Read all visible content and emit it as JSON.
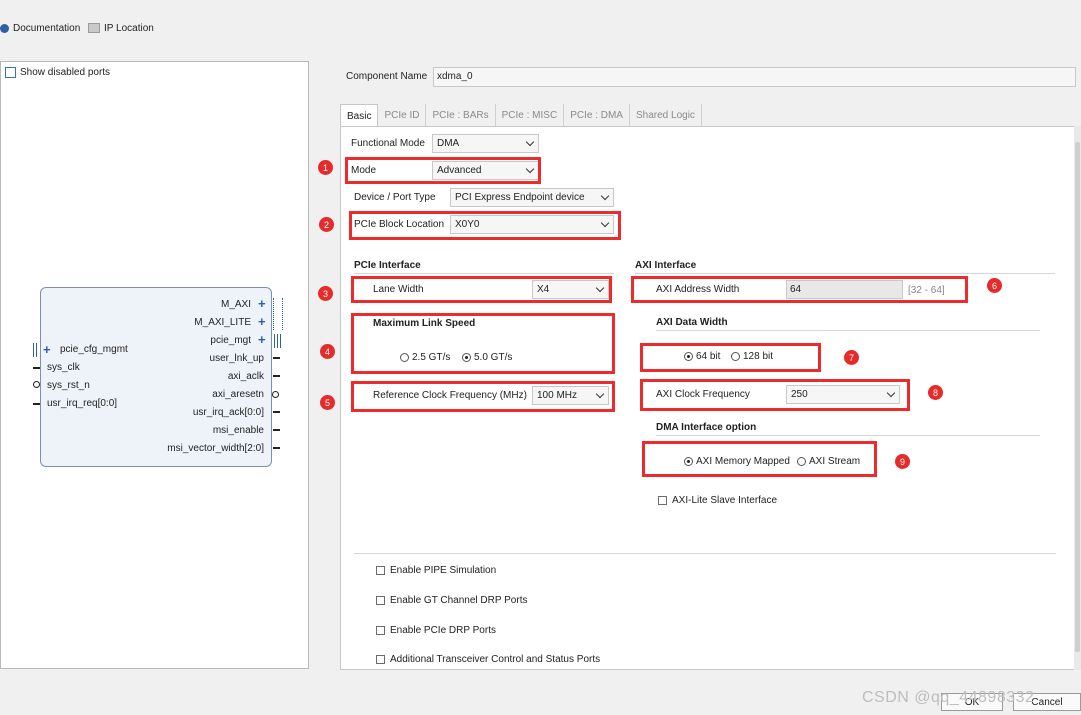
{
  "toolbar": {
    "documentation": "Documentation",
    "ip_location": "IP Location"
  },
  "left_panel": {
    "show_disabled_ports": "Show disabled ports",
    "ports_right": [
      "M_AXI",
      "M_AXI_LITE",
      "pcie_mgt",
      "user_lnk_up",
      "axi_aclk",
      "axi_aresetn",
      "usr_irq_ack[0:0]",
      "msi_enable",
      "msi_vector_width[2:0]"
    ],
    "ports_left": [
      "pcie_cfg_mgmt",
      "sys_clk",
      "sys_rst_n",
      "usr_irq_req[0:0]"
    ]
  },
  "component": {
    "label": "Component Name",
    "value": "xdma_0"
  },
  "tabs": [
    "Basic",
    "PCIe ID",
    "PCIe : BARs",
    "PCIe : MISC",
    "PCIe : DMA",
    "Shared Logic"
  ],
  "basic": {
    "functional_mode": {
      "label": "Functional Mode",
      "value": "DMA"
    },
    "mode": {
      "label": "Mode",
      "value": "Advanced"
    },
    "device_port_type": {
      "label": "Device / Port Type",
      "value": "PCI Express Endpoint device"
    },
    "pcie_block_location": {
      "label": "PCIe Block Location",
      "value": "X0Y0"
    },
    "pcie_interface": {
      "title": "PCIe Interface",
      "lane_width": {
        "label": "Lane Width",
        "value": "X4"
      },
      "max_link_speed": {
        "label": "Maximum Link Speed",
        "opt1": "2.5 GT/s",
        "opt2": "5.0 GT/s",
        "selected": "5.0 GT/s"
      },
      "ref_clock": {
        "label": "Reference Clock Frequency (MHz)",
        "value": "100 MHz"
      }
    },
    "axi_interface": {
      "title": "AXI Interface",
      "address_width": {
        "label": "AXI Address Width",
        "value": "64",
        "range": "[32 - 64]"
      },
      "data_width": {
        "title": "AXI Data Width",
        "opt1": "64 bit",
        "opt2": "128 bit",
        "selected": "64 bit"
      },
      "clock_freq": {
        "label": "AXI Clock Frequency",
        "value": "250"
      },
      "dma_interface": {
        "title": "DMA Interface option",
        "opt1": "AXI Memory Mapped",
        "opt2": "AXI Stream",
        "selected": "AXI Memory Mapped"
      },
      "axi_lite_slave": "AXI-Lite Slave Interface"
    },
    "checkboxes": [
      "Enable PIPE Simulation",
      "Enable GT Channel DRP Ports",
      "Enable PCIe DRP Ports",
      "Additional Transceiver Control and Status Ports"
    ]
  },
  "badges": [
    "1",
    "2",
    "3",
    "4",
    "5",
    "6",
    "7",
    "8",
    "9"
  ],
  "buttons": {
    "ok": "OK",
    "cancel": "Cancel"
  },
  "watermark": "CSDN @qq_44898332",
  "colors": {
    "annotation_red": "#ec2c2c",
    "badge_red": "#e62b2b",
    "accent_blue": "#2f5fa8"
  }
}
